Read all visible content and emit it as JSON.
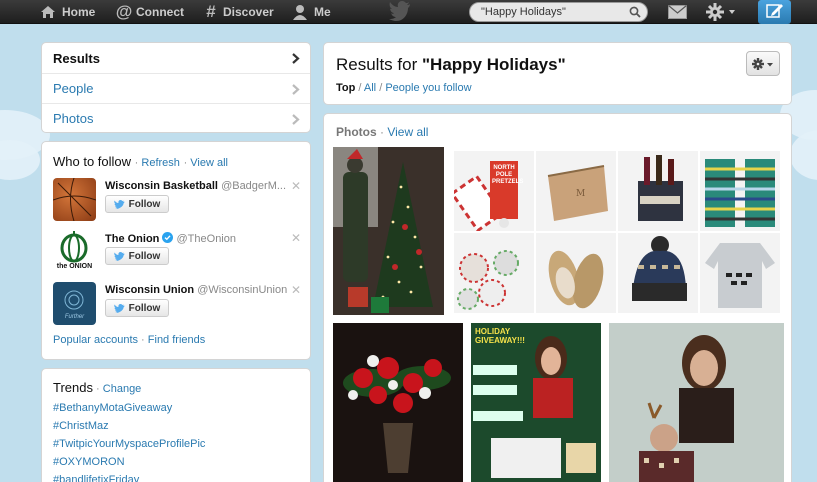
{
  "topnav": {
    "home": "Home",
    "connect": "Connect",
    "discover": "Discover",
    "me": "Me",
    "search_value": "\"Happy Holidays\""
  },
  "sidebar": {
    "items": [
      {
        "label": "Results"
      },
      {
        "label": "People"
      },
      {
        "label": "Photos"
      }
    ]
  },
  "who_to_follow": {
    "title": "Who to follow",
    "refresh": "Refresh",
    "view_all": "View all",
    "users": [
      {
        "name": "Wisconsin Basketball",
        "handle": "@BadgerM...",
        "button": "Follow"
      },
      {
        "name": "The Onion",
        "handle": "@TheOnion",
        "button": "Follow",
        "verified": true
      },
      {
        "name": "Wisconsin Union",
        "handle": "@WisconsinUnion",
        "button": "Follow"
      }
    ],
    "popular_accounts": "Popular accounts",
    "find_friends": "Find friends",
    "onion_logo_text": "the ONION",
    "union_logo_text": "Further"
  },
  "trends": {
    "title": "Trends",
    "change": "Change",
    "items": [
      "#BethanyMotaGiveaway",
      "#ChristMaz",
      "#TwitpicYourMyspaceProfilePic",
      "#OXYMORON",
      "#bandlifetixFriday"
    ]
  },
  "results": {
    "title_prefix": "Results for ",
    "query": "\"Happy Holidays\"",
    "filters": {
      "top": "Top",
      "all": "All",
      "people_you_follow": "People you follow"
    },
    "photos_label": "Photos",
    "photos_view_all": "View all",
    "product_text": "NORTH POLE PRETZELS",
    "giveaway_text": "HOLIDAY GIVEAWAY!!!"
  },
  "colors": {
    "accent": "#2a7ab0",
    "topbar": "#2a2a2a",
    "background": "#c0deed",
    "compose": "#3b94d9"
  }
}
